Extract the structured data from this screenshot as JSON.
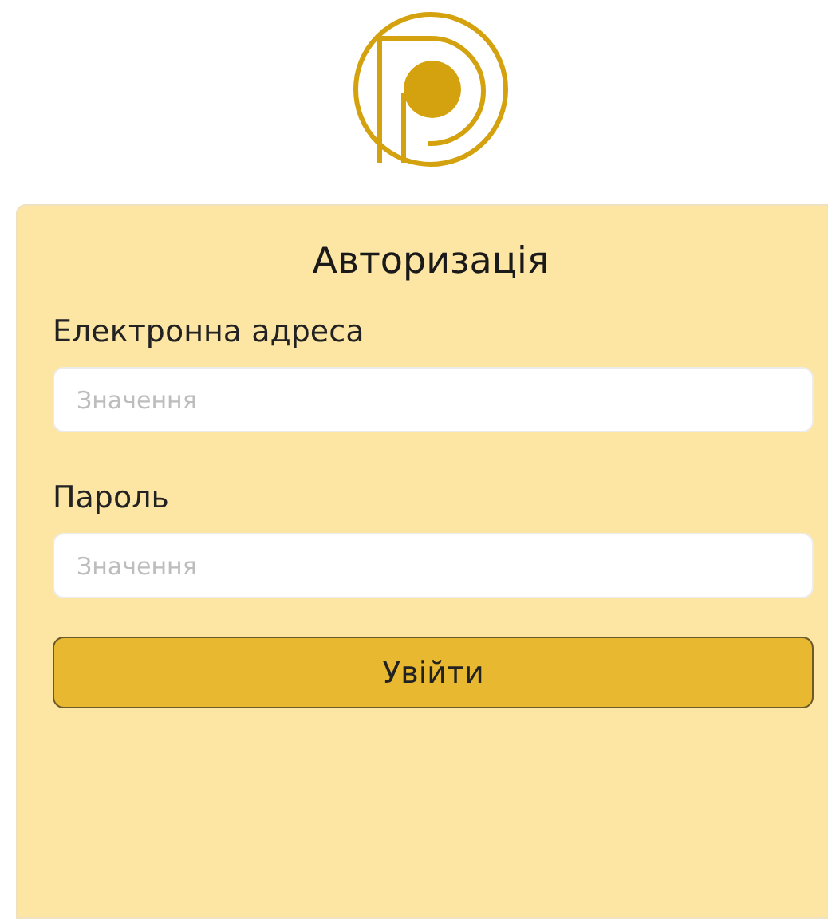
{
  "title": "Авторизація",
  "fields": [
    {
      "label": "Електронна адреса",
      "placeholder": "Значення"
    },
    {
      "label": "Пароль",
      "placeholder": "Значення"
    }
  ],
  "submit": "Увійти"
}
